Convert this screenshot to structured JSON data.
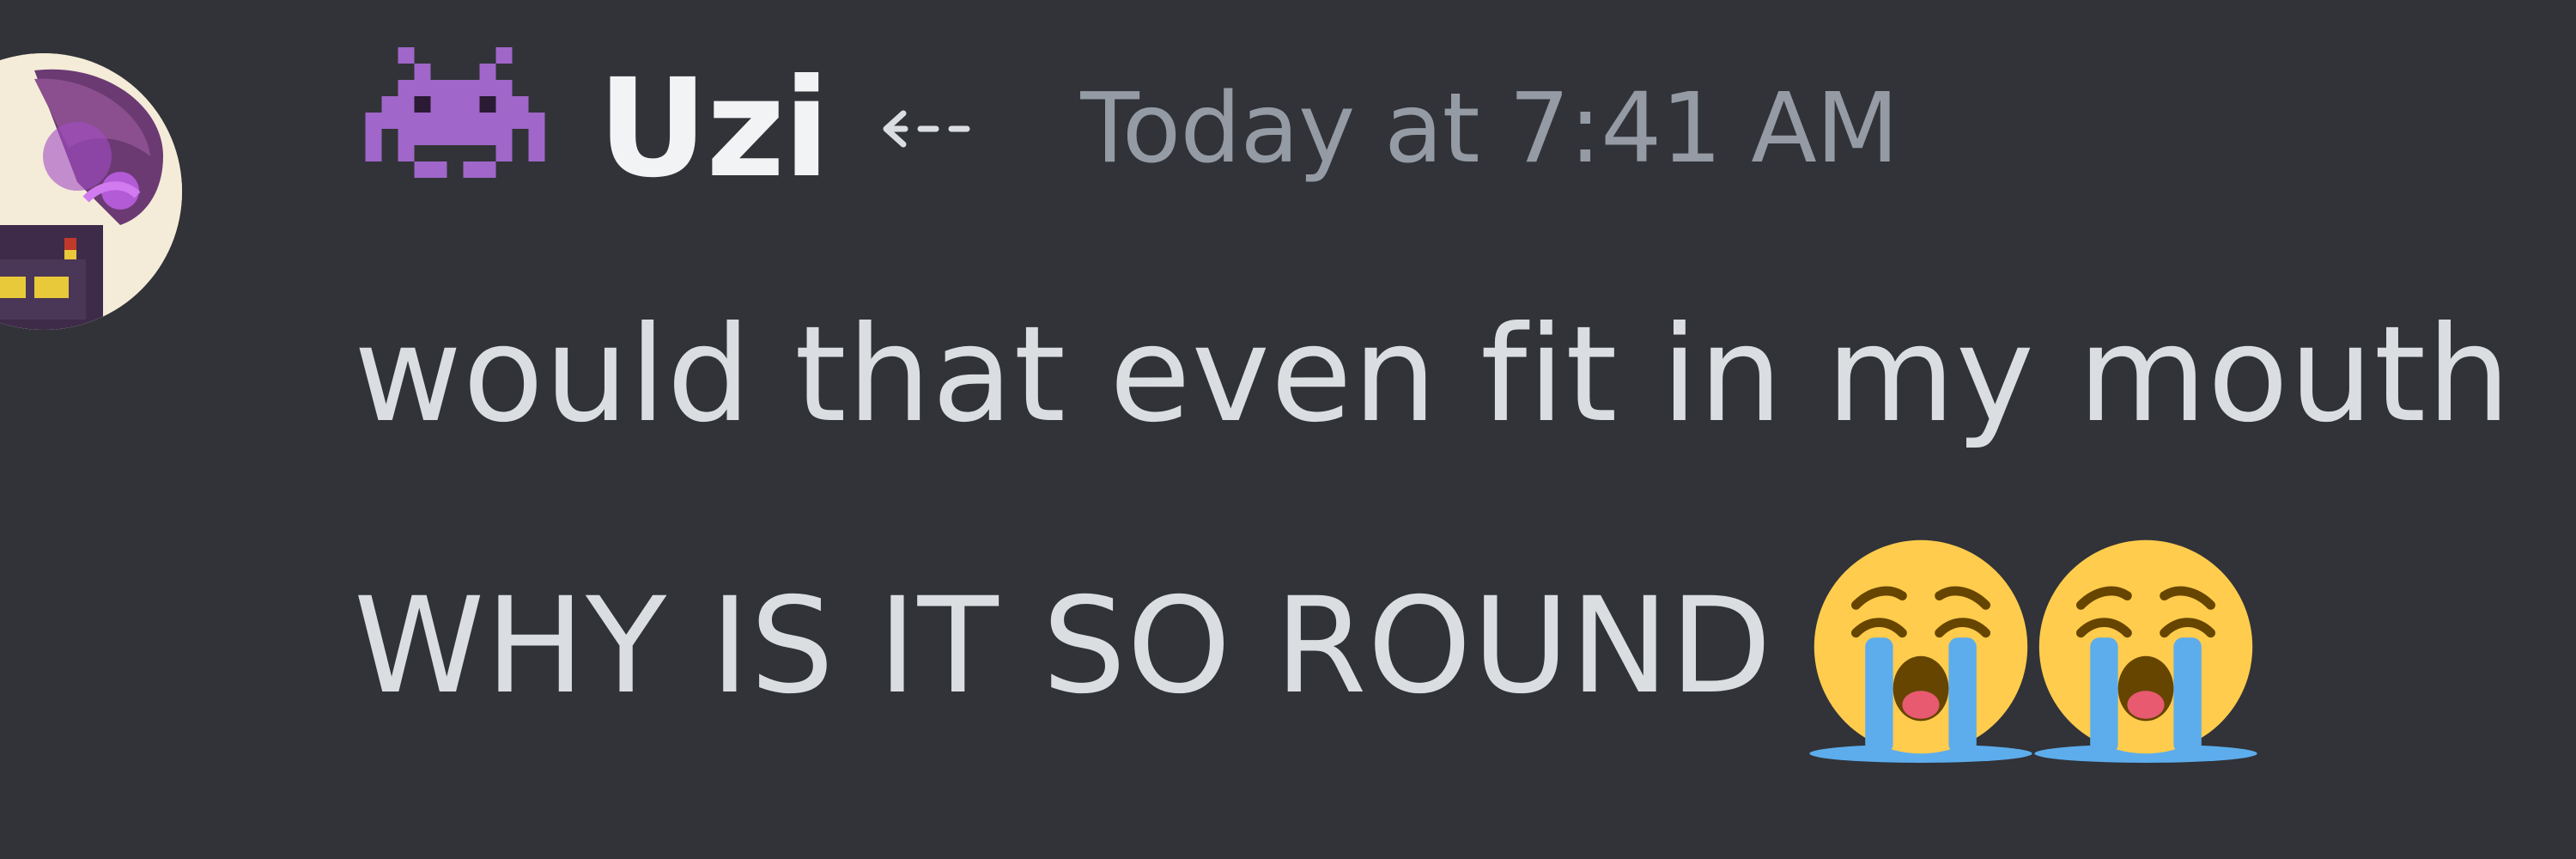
{
  "message": {
    "author": {
      "name": "Uzi",
      "name_prefix_icon": "space-invader-icon",
      "name_suffix_icon": "left-arrow-icon"
    },
    "timestamp": "Today at 7:41 AM",
    "lines": [
      "would that even fit in my mouth",
      "WHY IS IT SO ROUND"
    ],
    "emojis": [
      "loudly-crying-face-icon",
      "loudly-crying-face-icon"
    ]
  },
  "colors": {
    "background": "#313338",
    "username": "#f2f3f5",
    "timestamp": "#949ba4",
    "message_text": "#dbdee1",
    "invader": "#a066c9"
  }
}
